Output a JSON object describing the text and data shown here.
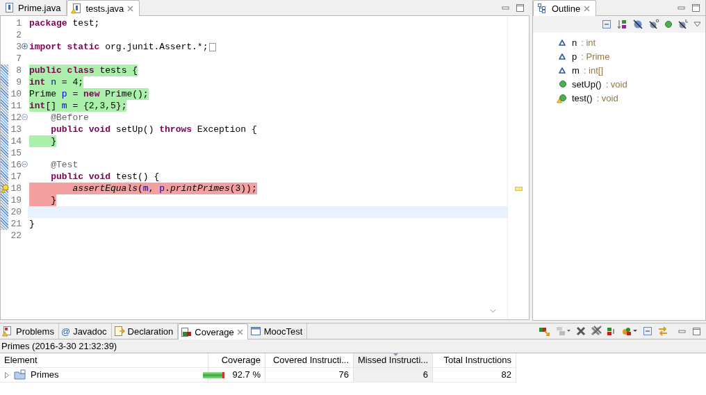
{
  "editor": {
    "tabs": [
      {
        "label": "Prime.java",
        "selected": false,
        "warning": false,
        "closable": false
      },
      {
        "label": "tests.java",
        "selected": true,
        "warning": true,
        "closable": true
      }
    ],
    "lines": [
      {
        "number": "1",
        "changed": false,
        "marker": false,
        "current": false,
        "tokens": [
          {
            "kind": "keyword",
            "text": "package"
          },
          {
            "kind": "plain",
            "text": " test;"
          }
        ]
      },
      {
        "number": "2",
        "changed": false,
        "marker": false,
        "current": false
      },
      {
        "number": "3",
        "collapsed": true,
        "changed": false,
        "marker": false,
        "current": false,
        "tokens": [
          {
            "kind": "keyword",
            "text": "import"
          },
          {
            "kind": "keyword",
            "text": " static"
          },
          {
            "kind": "plain",
            "text": " org.junit.Assert.*;"
          },
          {
            "kind": "folded"
          }
        ]
      },
      {
        "number": "7",
        "changed": false,
        "marker": false,
        "current": false
      },
      {
        "number": "8",
        "color": "#aaf0aa",
        "changed": true,
        "marker": false,
        "current": false,
        "tokens": [
          {
            "kind": "keyword",
            "text": "public"
          },
          {
            "kind": "keyword",
            "text": " class"
          },
          {
            "kind": "plain",
            "text": " tests {"
          }
        ]
      },
      {
        "number": "9",
        "color": "#aaf0aa",
        "changed": true,
        "marker": false,
        "current": false,
        "tokens": [
          {
            "kind": "keyword",
            "text": "int"
          },
          {
            "kind": "field",
            "text": " n"
          },
          {
            "kind": "plain",
            "text": " = 4;"
          }
        ]
      },
      {
        "number": "10",
        "color": "#aaf0aa",
        "changed": true,
        "marker": false,
        "current": false,
        "tokens": [
          {
            "kind": "plain",
            "text": "Prime"
          },
          {
            "kind": "field",
            "text": " p"
          },
          {
            "kind": "plain",
            "text": " ="
          },
          {
            "kind": "keyword",
            "text": " new"
          },
          {
            "kind": "plain",
            "text": " Prime();"
          }
        ]
      },
      {
        "number": "11",
        "color": "#aaf0aa",
        "changed": true,
        "marker": false,
        "current": false,
        "tokens": [
          {
            "kind": "keyword",
            "text": "int"
          },
          {
            "kind": "plain",
            "text": "[]"
          },
          {
            "kind": "field",
            "text": " m"
          },
          {
            "kind": "plain",
            "text": " = {2,3,5};"
          }
        ]
      },
      {
        "number": "12",
        "collapsed": false,
        "changed": true,
        "marker": false,
        "current": false,
        "tokens": [
          {
            "kind": "annotation",
            "text": "    @Before"
          }
        ]
      },
      {
        "number": "13",
        "changed": true,
        "marker": false,
        "current": false,
        "tokens": [
          {
            "kind": "keyword",
            "text": "    public"
          },
          {
            "kind": "keyword",
            "text": " void"
          },
          {
            "kind": "plain",
            "text": " setUp()"
          },
          {
            "kind": "keyword",
            "text": " throws"
          },
          {
            "kind": "plain",
            "text": " Exception {"
          }
        ]
      },
      {
        "number": "14",
        "color": "#aaf0aa",
        "changed": true,
        "marker": false,
        "current": false,
        "tokens": [
          {
            "kind": "plain",
            "text": "    }"
          }
        ]
      },
      {
        "number": "15",
        "changed": true,
        "marker": false,
        "current": false
      },
      {
        "number": "16",
        "collapsed": false,
        "changed": true,
        "marker": false,
        "current": false,
        "tokens": [
          {
            "kind": "annotation",
            "text": "    @Test"
          }
        ]
      },
      {
        "number": "17",
        "changed": true,
        "marker": false,
        "current": false,
        "tokens": [
          {
            "kind": "keyword",
            "text": "    public"
          },
          {
            "kind": "keyword",
            "text": " void"
          },
          {
            "kind": "plain",
            "text": " test() {"
          }
        ]
      },
      {
        "number": "18",
        "color": "#f5a0a0",
        "changed": true,
        "marker": true,
        "current": false,
        "tokens": [
          {
            "kind": "method",
            "text": "        assertEquals"
          },
          {
            "kind": "plain",
            "text": "("
          },
          {
            "kind": "field",
            "text": "m"
          },
          {
            "kind": "plain",
            "text": ","
          },
          {
            "kind": "field",
            "text": " p"
          },
          {
            "kind": "plain",
            "text": "."
          },
          {
            "kind": "method",
            "text": "printPrimes"
          },
          {
            "kind": "plain",
            "text": "(3));"
          }
        ]
      },
      {
        "number": "19",
        "color": "#f5a0a0",
        "changed": true,
        "marker": false,
        "current": false,
        "tokens": [
          {
            "kind": "plain",
            "text": "    }"
          }
        ]
      },
      {
        "number": "20",
        "changed": true,
        "marker": false,
        "current": true
      },
      {
        "number": "21",
        "changed": true,
        "marker": false,
        "current": false,
        "tokens": [
          {
            "kind": "plain",
            "text": "}"
          }
        ]
      },
      {
        "number": "22",
        "changed": false,
        "marker": false,
        "current": false
      }
    ]
  },
  "outline": {
    "tab": {
      "label": "Outline",
      "selected": true
    },
    "items": [
      {
        "kind": "field",
        "name": "n",
        "detail": ": int",
        "warning": false
      },
      {
        "kind": "field",
        "name": "p",
        "detail": ": Prime",
        "warning": false
      },
      {
        "kind": "field",
        "name": "m",
        "detail": ": int[]",
        "warning": false
      },
      {
        "kind": "method",
        "name": "setUp()",
        "detail": ": void",
        "warning": false
      },
      {
        "kind": "method",
        "name": "test()",
        "detail": ": void",
        "warning": true
      }
    ]
  },
  "bottom_panel": {
    "tabs": [
      {
        "label": "Problems",
        "selected": false,
        "closable": false
      },
      {
        "label": "Javadoc",
        "glyph": "@",
        "selected": false,
        "closable": false
      },
      {
        "label": "Declaration",
        "selected": false,
        "closable": false
      },
      {
        "label": "Coverage",
        "selected": true,
        "closable": true
      },
      {
        "label": "MoocTest",
        "selected": false,
        "closable": false
      }
    ],
    "session": "Primes (2016-3-30 21:32:39)",
    "table": {
      "columns": [
        {
          "label": "Element",
          "sorted": false
        },
        {
          "label": "Coverage",
          "sorted": false
        },
        {
          "label": "Covered Instructi...",
          "sorted": false
        },
        {
          "label": "Missed Instructi...",
          "sorted": true
        },
        {
          "label": "Total Instructions",
          "sorted": false
        }
      ],
      "rows": [
        {
          "name": "Primes",
          "expanded": false,
          "level": 0.927,
          "coverage": "92.7 %",
          "covered": "76",
          "missed": "6",
          "total": "82"
        }
      ]
    }
  }
}
